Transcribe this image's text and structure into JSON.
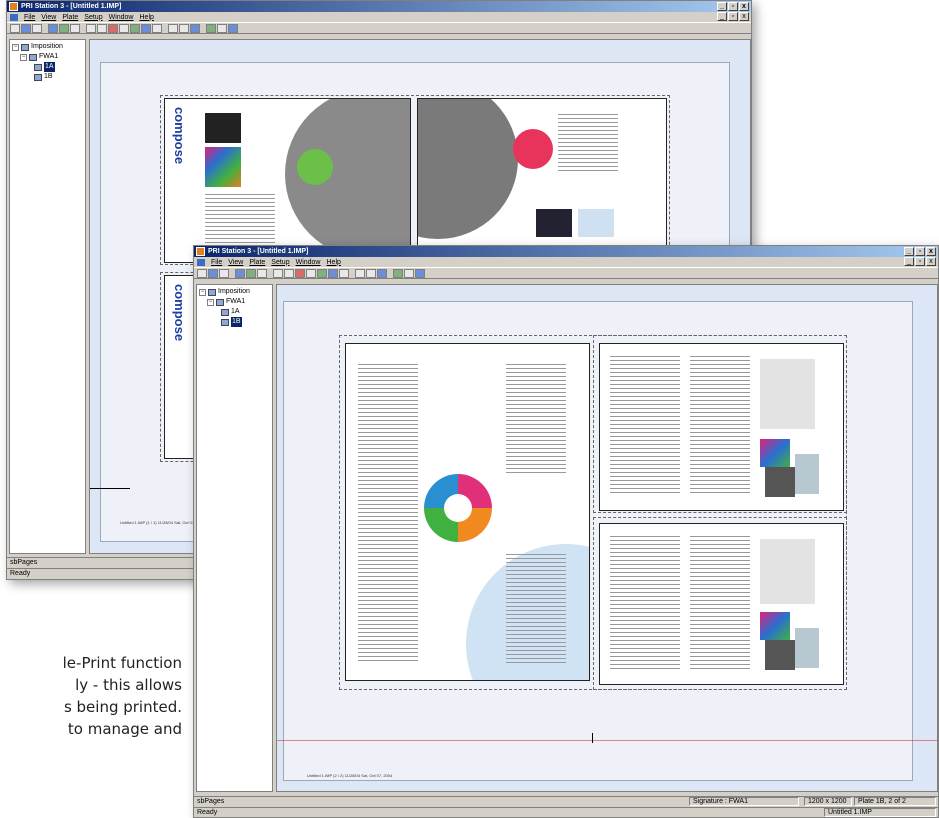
{
  "back_window": {
    "title": "PRI Station 3 - [Untitled 1.IMP]",
    "menu": [
      "File",
      "View",
      "Plate",
      "Setup",
      "Window",
      "Help"
    ],
    "tree": {
      "root": "Imposition",
      "child": "FWA1",
      "items": [
        "1A",
        "1B"
      ],
      "selected": "1A"
    },
    "page_word": "compose",
    "footer_caption": "Untitled 1.IMP (1 / 1) 11/28/04 Sat, Oct 07, 2004",
    "status_left": "sbPages",
    "status_ready": "Ready"
  },
  "front_window": {
    "title": "PRI Station 3 - [Untitled 1.IMP]",
    "menu": [
      "File",
      "View",
      "Plate",
      "Setup",
      "Window",
      "Help"
    ],
    "tree": {
      "root": "Imposition",
      "child": "FWA1",
      "items": [
        "1A",
        "1B"
      ],
      "selected": "1B"
    },
    "footer_caption": "Untitled 1.IMP (2 / 2) 11/28/04 Sat, Oct 07, 2004",
    "status_left": "sbPages",
    "signature": "Signature : FWA1",
    "resolution": "1200 x 1200",
    "plate": "Plate 1B, 2 of 2",
    "status_ready": "Ready",
    "document_name": "Untitled 1.IMP"
  },
  "window_buttons": {
    "minimize": "_",
    "restore": "▫",
    "close": "x"
  },
  "body_text": [
    "le-Print function",
    "ly - this allows",
    "s being printed.",
    "to manage and"
  ],
  "colors": {
    "titlebar": "#0a246a",
    "accent_blue": "#1c3fa0",
    "canvas": "#dde6f4"
  }
}
